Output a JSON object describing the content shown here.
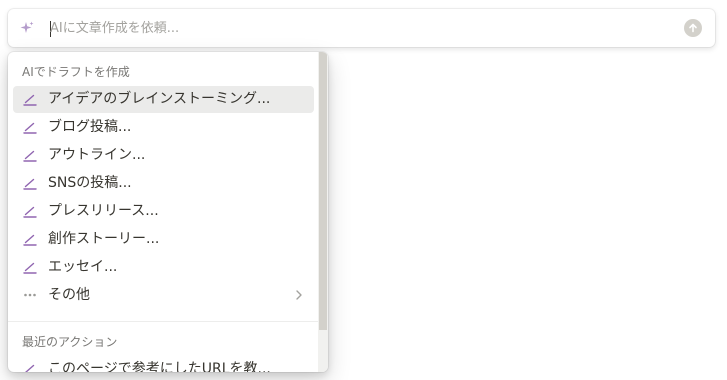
{
  "prompt": {
    "placeholder": "AIに文章作成を依頼...",
    "value": ""
  },
  "colors": {
    "accent_purple": "#9065b0",
    "selected_bg": "#ebebea",
    "submit_bg": "#d3d1cb"
  },
  "menu": {
    "section1_header": "AIでドラフトを作成",
    "items": [
      {
        "label": "アイデアのブレインストーミング...",
        "icon": "pencil-icon"
      },
      {
        "label": "ブログ投稿...",
        "icon": "pencil-icon"
      },
      {
        "label": "アウトライン...",
        "icon": "pencil-icon"
      },
      {
        "label": "SNSの投稿...",
        "icon": "pencil-icon"
      },
      {
        "label": "プレスリリース...",
        "icon": "pencil-icon"
      },
      {
        "label": "創作ストーリー...",
        "icon": "pencil-icon"
      },
      {
        "label": "エッセイ...",
        "icon": "pencil-icon"
      },
      {
        "label": "その他",
        "icon": "more-dots-icon"
      }
    ],
    "section2_header": "最近のアクション",
    "recent_items": [
      {
        "label": "このページで参考にしたURLを教...",
        "icon": "pencil-icon"
      }
    ]
  }
}
